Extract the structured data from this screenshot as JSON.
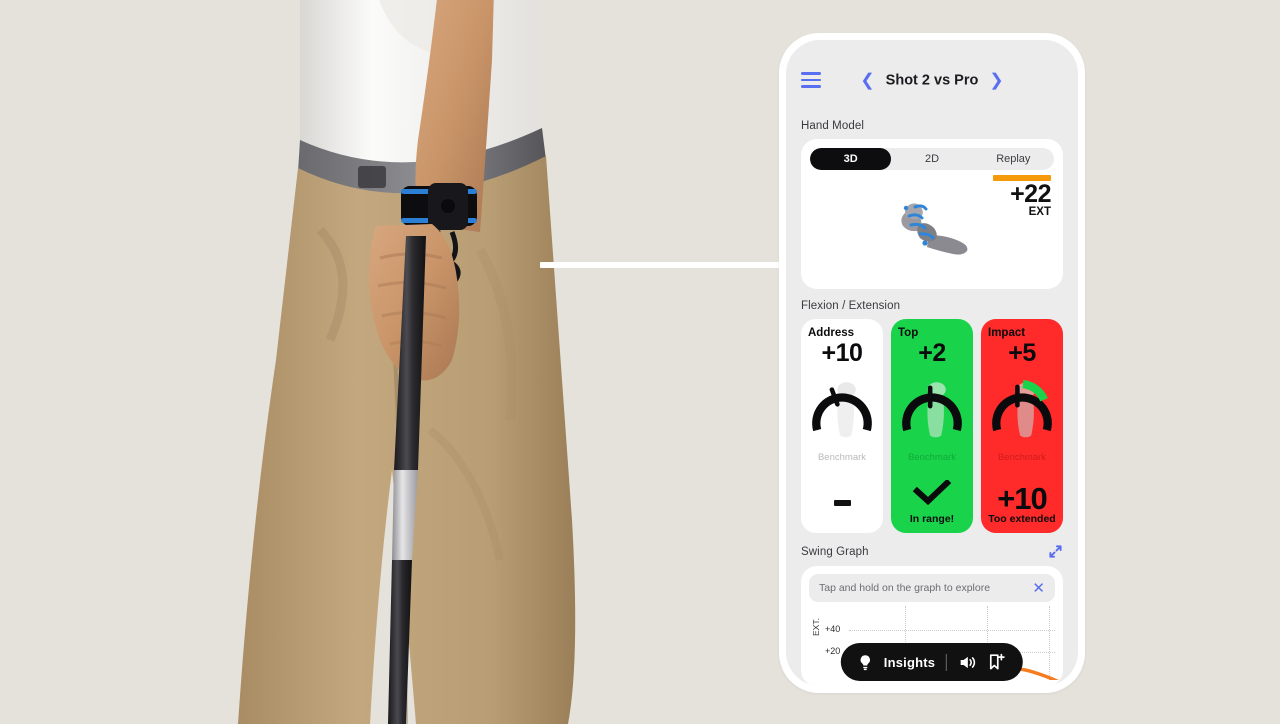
{
  "background_color": "#e5e1db",
  "photo": {
    "alt": "golfer-gripping-club-with-wrist-sensor",
    "sensor": "black-wrist-sensor-with-blue-trim"
  },
  "phone": {
    "header": {
      "menu_icon": "hamburger-icon",
      "prev_icon": "chevron-left-icon",
      "title": "Shot 2 vs Pro",
      "next_icon": "chevron-right-icon",
      "accent_color": "#5a6ef0"
    },
    "hand_model": {
      "section_label": "Hand Model",
      "tabs": [
        {
          "label": "3D",
          "active": true
        },
        {
          "label": "2D",
          "active": false
        },
        {
          "label": "Replay",
          "active": false
        }
      ],
      "badge": {
        "bar_color": "#f59a0b",
        "value": "+22",
        "unit": "EXT"
      },
      "model_icon": "hand-3d-model"
    },
    "flexion_extension": {
      "section_label": "Flexion / Extension",
      "cards": [
        {
          "title": "Address",
          "value": "+10",
          "benchmark_label": "Benchmark",
          "footer_value": "-",
          "footer_text": "",
          "bg_color": "#ffffff",
          "state": "neutral"
        },
        {
          "title": "Top",
          "value": "+2",
          "benchmark_label": "Benchmark",
          "footer_value": "",
          "footer_text": "In range!",
          "bg_color": "#19d44a",
          "state": "in-range"
        },
        {
          "title": "Impact",
          "value": "+5",
          "benchmark_label": "Benchmark",
          "footer_value": "+10",
          "footer_text": "Too extended",
          "bg_color": "#ff2a2a",
          "state": "too-extended"
        }
      ]
    },
    "swing_graph": {
      "section_label": "Swing Graph",
      "expand_icon": "expand-arrows-icon",
      "tooltip": {
        "text": "Tap and hold on the graph to explore",
        "close_icon": "close-icon"
      },
      "chart_data": {
        "type": "line",
        "title": "Swing Graph",
        "ylabel": "EXT.",
        "xlabel": "",
        "yticks": [
          "+40",
          "+20"
        ],
        "ylim": [
          0,
          50
        ],
        "grid": true,
        "legend": "none",
        "series": [
          {
            "name": "benchmark-band",
            "color": "#111111",
            "type": "bar"
          },
          {
            "name": "shot-trace",
            "color": "#f57c1f",
            "type": "line"
          }
        ],
        "marker": "red-green-flag-marker"
      }
    },
    "insights_pill": {
      "bulb_icon": "lightbulb-icon",
      "label": "Insights",
      "sound_icon": "speaker-icon",
      "share_icon": "bookmark-plus-icon"
    }
  }
}
